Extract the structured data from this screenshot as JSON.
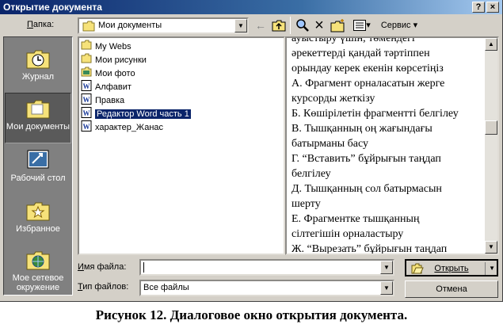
{
  "window": {
    "title": "Открытие документа",
    "help_glyph": "?",
    "close_glyph": "×"
  },
  "lookin": {
    "label": "Папка:",
    "value": "Мои документы"
  },
  "toolbar": {
    "back_glyph": "←",
    "delete_glyph": "×",
    "views_glyph": "▾",
    "tools_label": "Сервис",
    "tools_arrow": "▾"
  },
  "places": [
    {
      "label": "Журнал",
      "icon": "history-icon"
    },
    {
      "label": "Мои документы",
      "icon": "my-documents-icon",
      "selected": true
    },
    {
      "label": "Рабочий стол",
      "icon": "desktop-icon"
    },
    {
      "label": "Избранное",
      "icon": "favorites-icon"
    },
    {
      "label": "Мое сетевое окружение",
      "icon": "network-icon"
    }
  ],
  "files": [
    {
      "name": "My Webs",
      "type": "folder"
    },
    {
      "name": "Мои рисунки",
      "type": "folder"
    },
    {
      "name": "Мои фото",
      "type": "photo-folder"
    },
    {
      "name": "Алфавит",
      "type": "word-doc"
    },
    {
      "name": "Правка",
      "type": "word-doc"
    },
    {
      "name": "Редактор Word часть 1",
      "type": "word-doc",
      "selected": true
    },
    {
      "name": "характер_Жанас",
      "type": "word-doc"
    }
  ],
  "preview_lines": [
    "ауыстыру үшін, төмендегі",
    "әрекеттерді қандай тәртіппен",
    "орындау керек екенін көрсетіңіз",
    "А. Фрагмент орналасатын жерге",
    "курсорды жеткізу",
    "Б. Көшірілетін фрагментті белгілеу",
    "В. Тышқанның оң жағындағы",
    "батырманы басу",
    "Г. “Вставить” бұйрығын таңдап",
    "белгілеу",
    "Д. Тышқанның сол батырмасын",
    "шерту",
    "Е. Фрагментке тышқанның",
    "сілтегішін орналастыру",
    "Ж. “Вырезать” бұйрығын таңдап"
  ],
  "filename": {
    "label": "Имя файла:",
    "value": ""
  },
  "filetype": {
    "label": "Тип файлов:",
    "value": "Все файлы"
  },
  "buttons": {
    "open": "Открыть",
    "cancel": "Отмена"
  },
  "caption": "Рисунок 12. Диалоговое окно открытия документа."
}
